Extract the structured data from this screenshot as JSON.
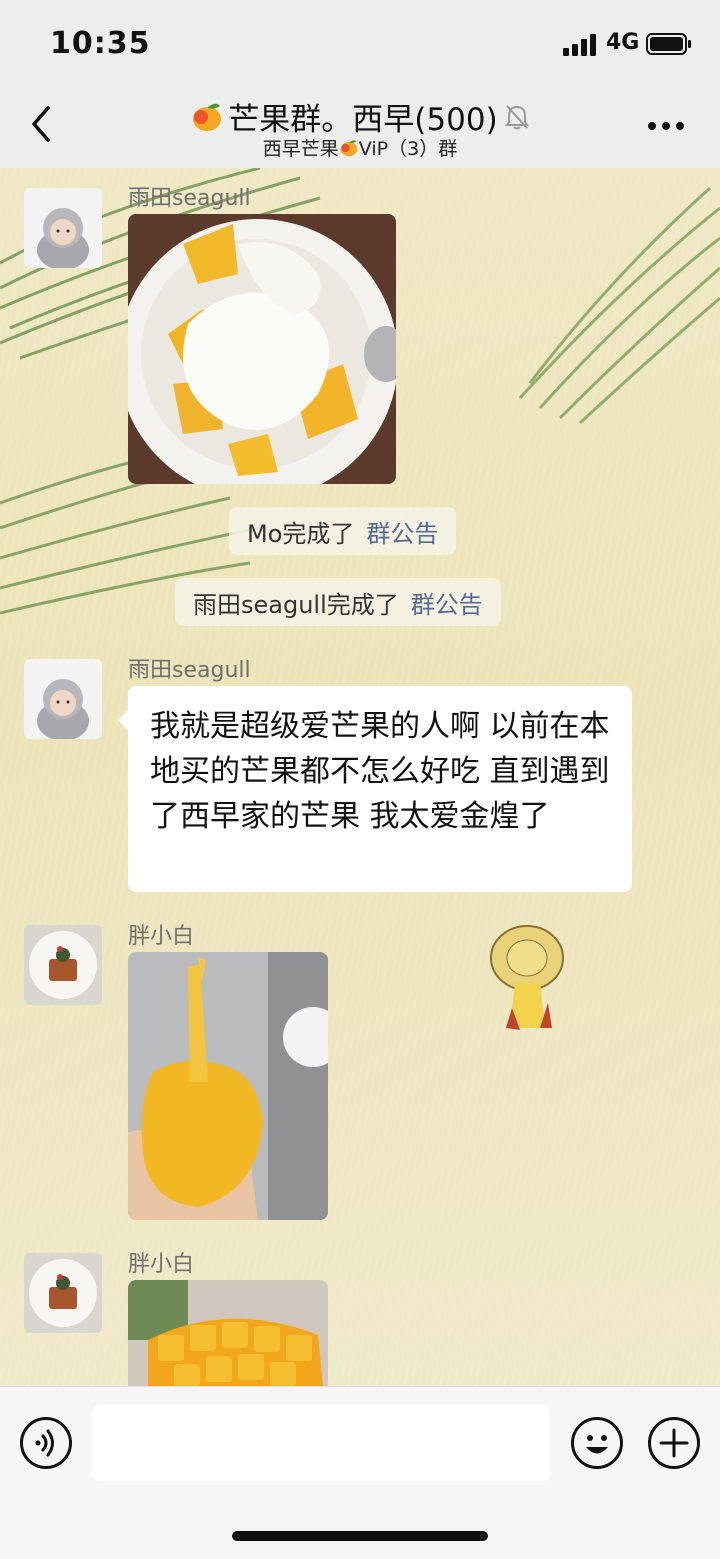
{
  "status_bar": {
    "time": "10:35",
    "network": "4G"
  },
  "header": {
    "title": "芒果群。西早(500)",
    "subtitle_left": "西早芒果",
    "subtitle_right": "ViP（3）群",
    "title_icon": "mango-icon",
    "mute_icon": "muted-bell-icon"
  },
  "messages": [
    {
      "type": "image",
      "sender": "雨田seagull",
      "content": "mango-yogurt-photo"
    },
    {
      "type": "system",
      "text": "Mo完成了",
      "link": "群公告"
    },
    {
      "type": "system",
      "text": "雨田seagull完成了",
      "link": "群公告"
    },
    {
      "type": "text",
      "sender": "雨田seagull",
      "text": "我就是超级爱芒果的人啊 以前在本地买的芒果都不怎么好吃 直到遇到了西早家的芒果 我太爱金煌了"
    },
    {
      "type": "image",
      "sender": "胖小白",
      "content": "mango-on-stick-photo"
    },
    {
      "type": "image",
      "sender": "胖小白",
      "content": "cubed-mango-photo"
    }
  ],
  "input_bar": {
    "placeholder": ""
  },
  "colors": {
    "bar_bg": "#ededed",
    "link": "#546b95",
    "sender": "#6f6f6f"
  }
}
